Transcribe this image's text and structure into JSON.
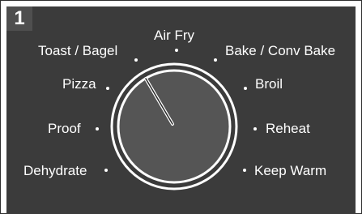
{
  "step_number": "1",
  "colors": {
    "panel": "#3b3b3b",
    "knob_face": "#555555",
    "knob_ring": "#ffffff",
    "text": "#ffffff"
  },
  "dial": {
    "selected": "Toast / Bagel",
    "settings": [
      {
        "key": "air_fry",
        "label": "Air Fry"
      },
      {
        "key": "toast_bagel",
        "label": "Toast / Bagel"
      },
      {
        "key": "bake_conv_bake",
        "label": "Bake / Conv Bake"
      },
      {
        "key": "pizza",
        "label": "Pizza"
      },
      {
        "key": "broil",
        "label": "Broil"
      },
      {
        "key": "proof",
        "label": "Proof"
      },
      {
        "key": "reheat",
        "label": "Reheat"
      },
      {
        "key": "dehydrate",
        "label": "Dehydrate"
      },
      {
        "key": "keep_warm",
        "label": "Keep Warm"
      }
    ]
  }
}
